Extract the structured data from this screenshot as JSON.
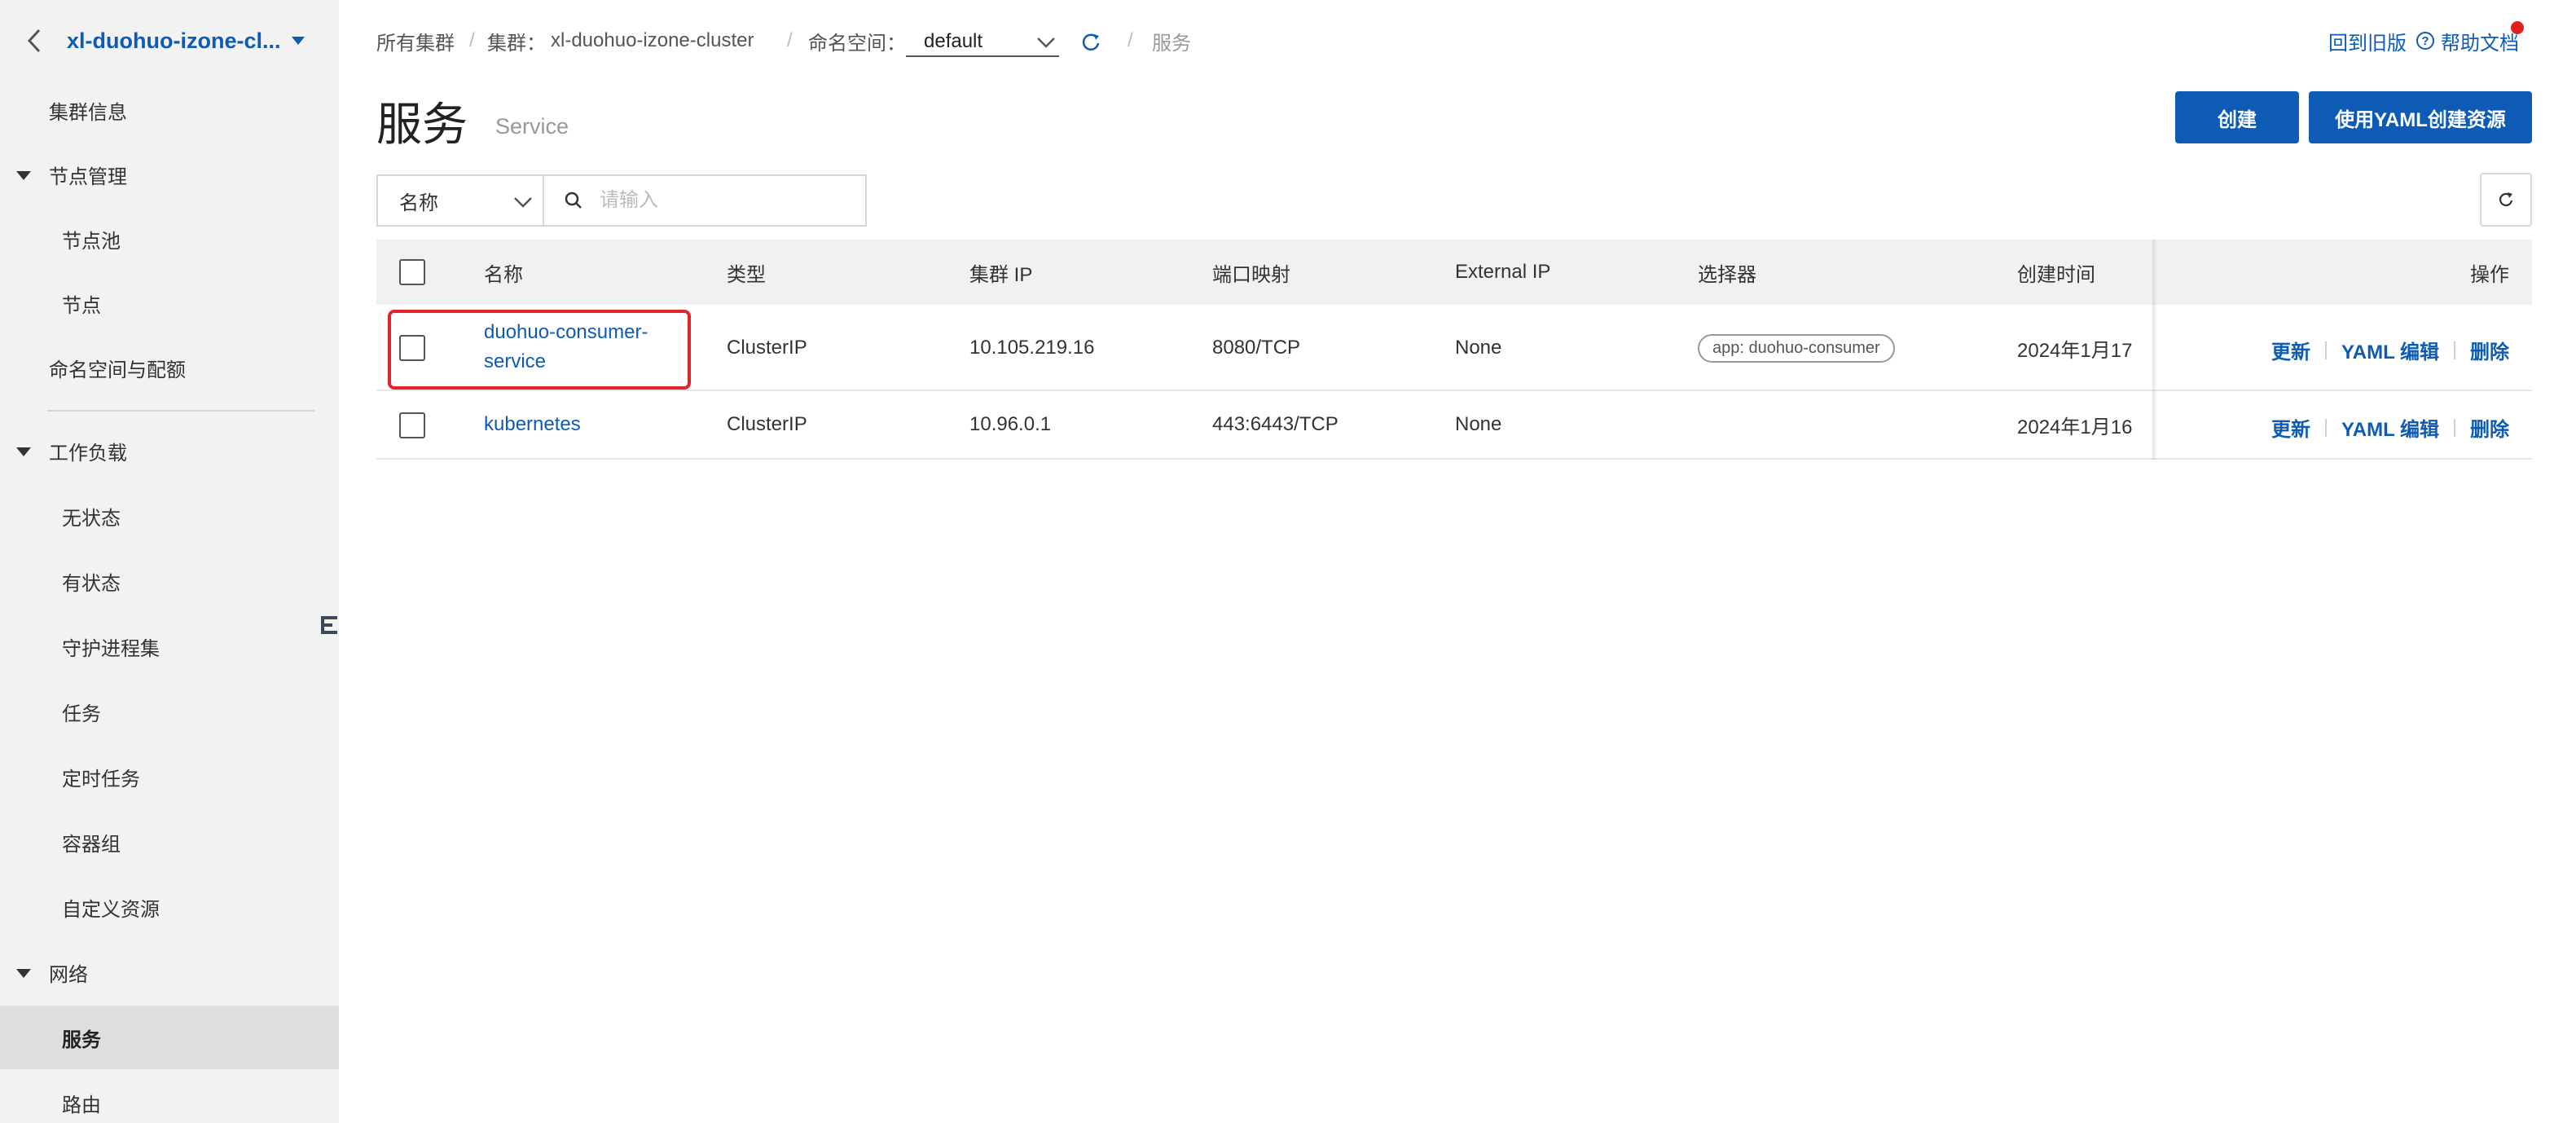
{
  "sidebar": {
    "cluster_name": "xl-duohuo-izone-cl...",
    "items": [
      {
        "label": "集群信息"
      },
      {
        "label": "节点管理"
      },
      {
        "label": "节点池"
      },
      {
        "label": "节点"
      },
      {
        "label": "命名空间与配额"
      },
      {
        "label": "工作负载"
      },
      {
        "label": "无状态"
      },
      {
        "label": "有状态"
      },
      {
        "label": "守护进程集"
      },
      {
        "label": "任务"
      },
      {
        "label": "定时任务"
      },
      {
        "label": "容器组"
      },
      {
        "label": "自定义资源"
      },
      {
        "label": "网络"
      },
      {
        "label": "服务"
      },
      {
        "label": "路由"
      }
    ]
  },
  "breadcrumb": {
    "all_clusters": "所有集群",
    "sep": "/",
    "cluster_label": "集群：",
    "cluster_value": "xl-duohuo-izone-cluster",
    "namespace_label": "命名空间：",
    "namespace_value": "default",
    "current": "服务"
  },
  "header": {
    "back_to_old": "回到旧版",
    "help_docs": "帮助文档",
    "help_glyph": "?"
  },
  "page": {
    "title": "服务",
    "subtitle": "Service",
    "create_button": "创建",
    "yaml_create_button": "使用YAML创建资源"
  },
  "filter": {
    "field": "名称",
    "placeholder": "请输入"
  },
  "table": {
    "columns": [
      "名称",
      "类型",
      "集群 IP",
      "端口映射",
      "External IP",
      "选择器",
      "创建时间",
      "操作"
    ],
    "rows": [
      {
        "name_line1": "duohuo-consumer-",
        "name_line2": "service",
        "type": "ClusterIP",
        "cluster_ip": "10.105.219.16",
        "ports": "8080/TCP",
        "external_ip": "None",
        "selector": "app: duohuo-consumer",
        "created": "2024年1月17"
      },
      {
        "name_line1": "kubernetes",
        "name_line2": "",
        "type": "ClusterIP",
        "cluster_ip": "10.96.0.1",
        "ports": "443:6443/TCP",
        "external_ip": "None",
        "selector": "",
        "created": "2024年1月16"
      }
    ],
    "actions": {
      "update": "更新",
      "yaml_edit": "YAML 编辑",
      "delete": "删除"
    }
  },
  "colors": {
    "accent": "#0d5bb5",
    "highlight": "#e0262c",
    "sidebar_bg": "#f2f2f2",
    "table_header_bg": "#f0f1f3"
  }
}
